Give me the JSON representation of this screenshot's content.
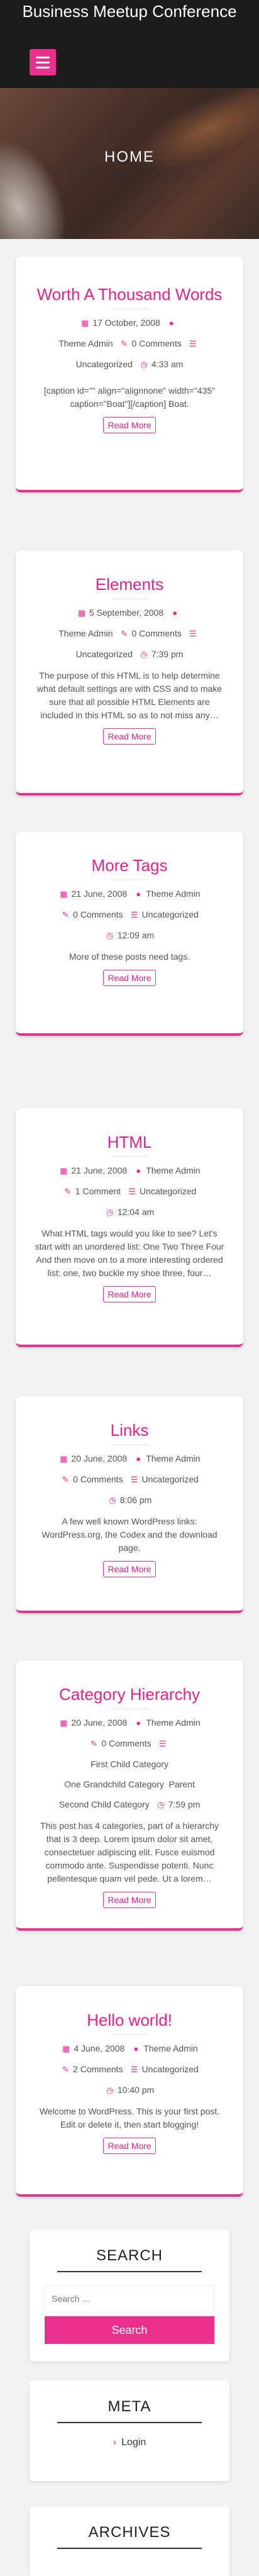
{
  "site": {
    "title": "Business Meetup Conference"
  },
  "hero": {
    "title": "HOME"
  },
  "posts": [
    {
      "title": "Worth A Thousand Words",
      "date": "17 October, 2008",
      "author": "Theme Admin",
      "comments": "0 Comments",
      "category": "Uncategorized",
      "time": "4:33 am",
      "excerpt": "[caption id=\"\" align=\"alignnone\" width=\"435\" caption=\"Boat\"][/caption] Boat.",
      "read_more": "Read More"
    },
    {
      "title": "Elements",
      "date": "5 September, 2008",
      "author": "Theme Admin",
      "comments": "0 Comments",
      "category": "Uncategorized",
      "time": "7:39 pm",
      "excerpt": "The purpose of this HTML is to help determine what default settings are with CSS and to make sure that all possible HTML Elements are included in this HTML so as to not miss any…",
      "read_more": "Read More"
    },
    {
      "title": "More Tags",
      "date": "21 June, 2008",
      "author": "Theme Admin",
      "comments": "0 Comments",
      "category": "Uncategorized",
      "time": "12:09 am",
      "excerpt": "More of these posts need tags.",
      "read_more": "Read More"
    },
    {
      "title": "HTML",
      "date": "21 June, 2008",
      "author": "Theme Admin",
      "comments": "1 Comment",
      "category": "Uncategorized",
      "time": "12:04 am",
      "excerpt": "What HTML tags would you like to see? Let's start with an unordered list: One Two Three Four And then move on to a more interesting ordered list: one, two buckle my shoe three, four…",
      "read_more": "Read More"
    },
    {
      "title": "Links",
      "date": "20 June, 2008",
      "author": "Theme Admin",
      "comments": "0 Comments",
      "category": "Uncategorized",
      "time": "8:06 pm",
      "excerpt": "A few well known WordPress links: WordPress.org, the Codex and the download page.",
      "read_more": "Read More"
    },
    {
      "title": "Category Hierarchy",
      "date": "20 June, 2008",
      "author": "Theme Admin",
      "comments": "0 Comments",
      "category": "First Child Category",
      "category2": "One Grandchild Category",
      "category3": "Parent",
      "category4": "Second Child Category",
      "time": "7:59 pm",
      "excerpt": "This post has 4 categories, part of a hierarchy that is 3 deep. Lorem ipsum dolor sit amet, consectetuer adipiscing elit. Fusce euismod commodo ante. Suspendisse potenti. Nunc pellentesque quam vel pede. Ut a lorem…",
      "read_more": "Read More"
    },
    {
      "title": "Hello world!",
      "date": "4 June, 2008",
      "author": "Theme Admin",
      "comments": "2 Comments",
      "category": "Uncategorized",
      "time": "10:40 pm",
      "excerpt": "Welcome to WordPress. This is your first post. Edit or delete it, then start blogging!",
      "read_more": "Read More"
    }
  ],
  "widgets": {
    "search": {
      "title": "SEARCH",
      "placeholder": "Search ...",
      "button": "Search"
    },
    "meta": {
      "title": "META",
      "login": "Login"
    },
    "archives": {
      "title": "ARCHIVES"
    }
  },
  "icons": {
    "calendar": "calendar-icon",
    "user": "user-icon",
    "comments": "comments-icon",
    "list": "list-icon",
    "clock": "clock-icon"
  },
  "colors": {
    "accent": "#ea2f8d",
    "header": "#1c1c1c"
  }
}
